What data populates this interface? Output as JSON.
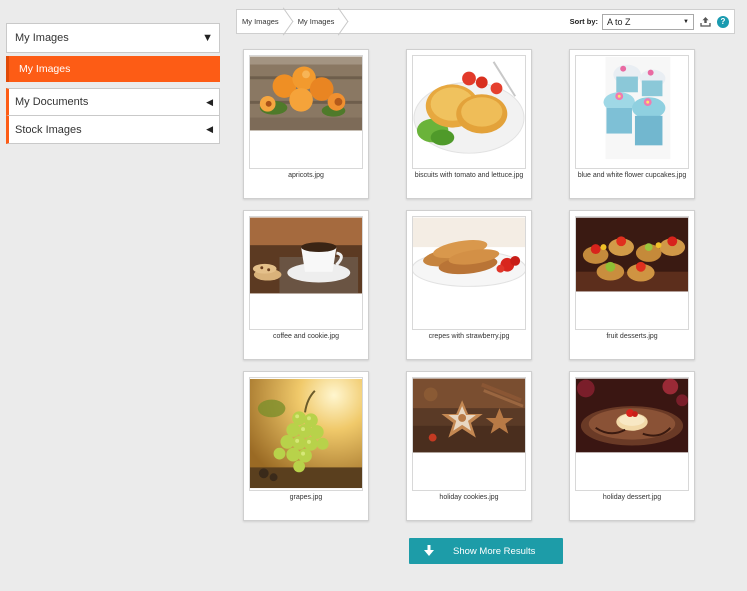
{
  "sidebar": {
    "header": {
      "label": "My Images",
      "icon": "caret-down-icon"
    },
    "active_item": "My Images",
    "items": [
      {
        "label": "My Documents",
        "icon": "caret-left-icon"
      },
      {
        "label": "Stock Images",
        "icon": "caret-left-icon"
      }
    ]
  },
  "topbar": {
    "breadcrumbs": [
      "My Images",
      "My Images"
    ],
    "sort_label": "Sort by:",
    "sort_value": "A to Z",
    "upload_icon": "upload-icon",
    "help_icon": "help-icon",
    "help_glyph": "?"
  },
  "images": [
    {
      "caption": "apricots.jpg",
      "scene": "apricots"
    },
    {
      "caption": "biscuits with tomato and lettuce.jpg",
      "scene": "biscuits"
    },
    {
      "caption": "blue and white flower cupcakes.jpg",
      "scene": "cupcakes"
    },
    {
      "caption": "coffee and cookie.jpg",
      "scene": "coffee"
    },
    {
      "caption": "crepes with strawberry.jpg",
      "scene": "crepes"
    },
    {
      "caption": "fruit desserts.jpg",
      "scene": "fruit"
    },
    {
      "caption": "grapes.jpg",
      "scene": "grapes"
    },
    {
      "caption": "holiday cookies.jpg",
      "scene": "cookies"
    },
    {
      "caption": "holiday dessert.jpg",
      "scene": "dessert"
    }
  ],
  "show_more": {
    "label": "Show More Results",
    "icon": "arrow-down-icon"
  },
  "colors": {
    "accent": "#fd5c15",
    "button": "#1d9ca8",
    "help": "#1a9bb0"
  }
}
